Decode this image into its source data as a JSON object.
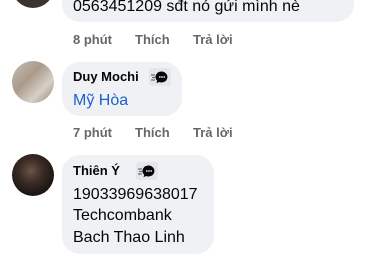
{
  "comments": [
    {
      "text_lines": [
        "0563451209 sđt nó gửi mình nè"
      ],
      "time": "8 phút",
      "like_label": "Thích",
      "reply_label": "Trả lời"
    },
    {
      "name": "Duy Mochi",
      "text_lines": [
        "Mỹ Hòa"
      ],
      "time": "7 phút",
      "like_label": "Thích",
      "reply_label": "Trả lời"
    },
    {
      "name": "Thiên Ý",
      "text_lines": [
        "19033969638017",
        "Techcombank",
        "Bach Thao Linh"
      ]
    }
  ],
  "icons": {
    "author_badge": "messenger-chat-icon"
  },
  "colors": {
    "bubble": "#eff1f4",
    "link": "#1c61c9",
    "meta": "#65676b"
  }
}
